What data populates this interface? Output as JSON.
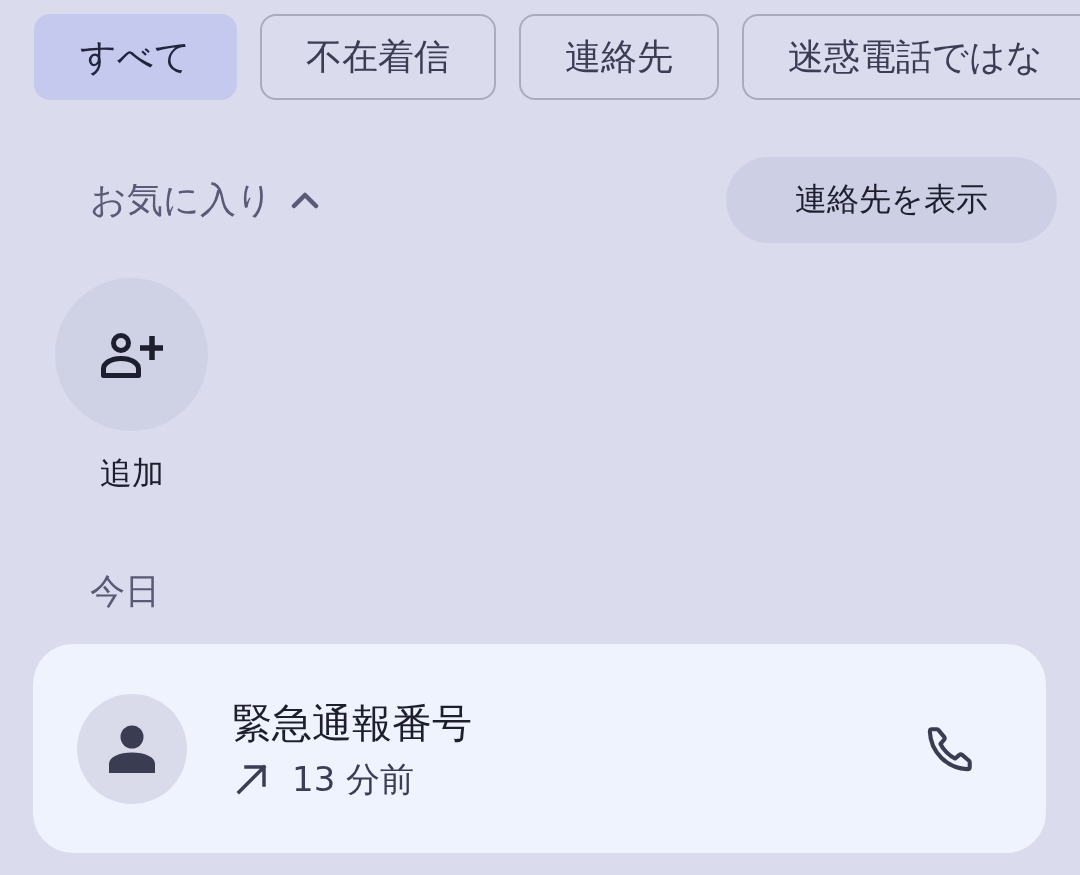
{
  "filter_chips": [
    {
      "label": "すべて",
      "selected": true
    },
    {
      "label": "不在着信",
      "selected": false
    },
    {
      "label": "連絡先",
      "selected": false
    },
    {
      "label": "迷惑電話ではな",
      "selected": false
    }
  ],
  "favorites": {
    "title": "お気に入り",
    "expanded": true,
    "show_contacts_button": "連絡先を表示",
    "add_tile": {
      "label": "追加"
    }
  },
  "recents": {
    "section_title": "今日",
    "calls": [
      {
        "name": "緊急通報番号",
        "kind": "outgoing",
        "time": "13 分前"
      }
    ]
  }
}
